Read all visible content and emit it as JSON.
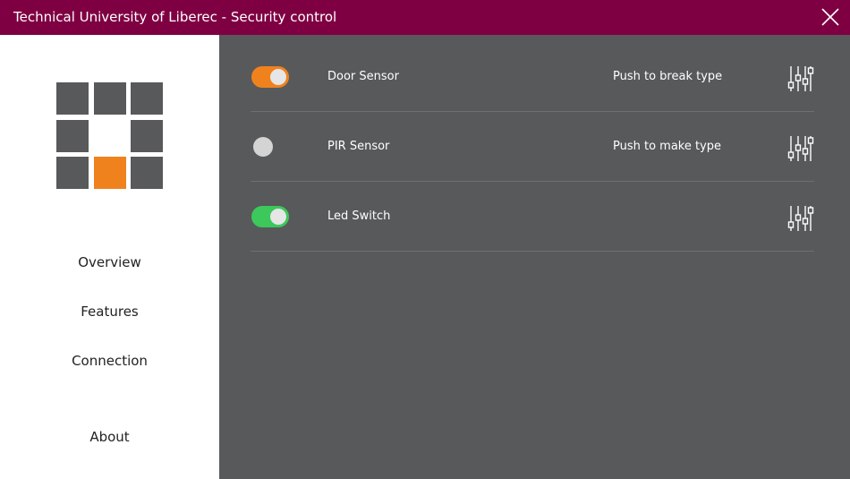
{
  "app": {
    "title": "Technical University of Liberec - Security control"
  },
  "colors": {
    "titlebar": "#7f0042",
    "sidebar": "#ffffff",
    "content": "#58595b",
    "accent_orange": "#f0821e",
    "accent_green": "#3cc85a"
  },
  "sidebar": {
    "logo": "grid-logo",
    "items": [
      {
        "label": "Overview"
      },
      {
        "label": "Features"
      },
      {
        "label": "Connection"
      },
      {
        "label": "About"
      }
    ]
  },
  "devices": [
    {
      "label": "Door Sensor",
      "type": "Push to break type",
      "state": "on",
      "toggle_color": "#f0821e",
      "icon": "sliders-icon"
    },
    {
      "label": "PIR Sensor",
      "type": "Push to make type",
      "state": "off",
      "toggle_color": "#d4d4d4",
      "icon": "sliders-icon"
    },
    {
      "label": "Led Switch",
      "type": "",
      "state": "on",
      "toggle_color": "#3cc85a",
      "icon": "sliders-icon"
    }
  ],
  "icons": {
    "close": "close-icon",
    "settings": "sliders-icon"
  }
}
